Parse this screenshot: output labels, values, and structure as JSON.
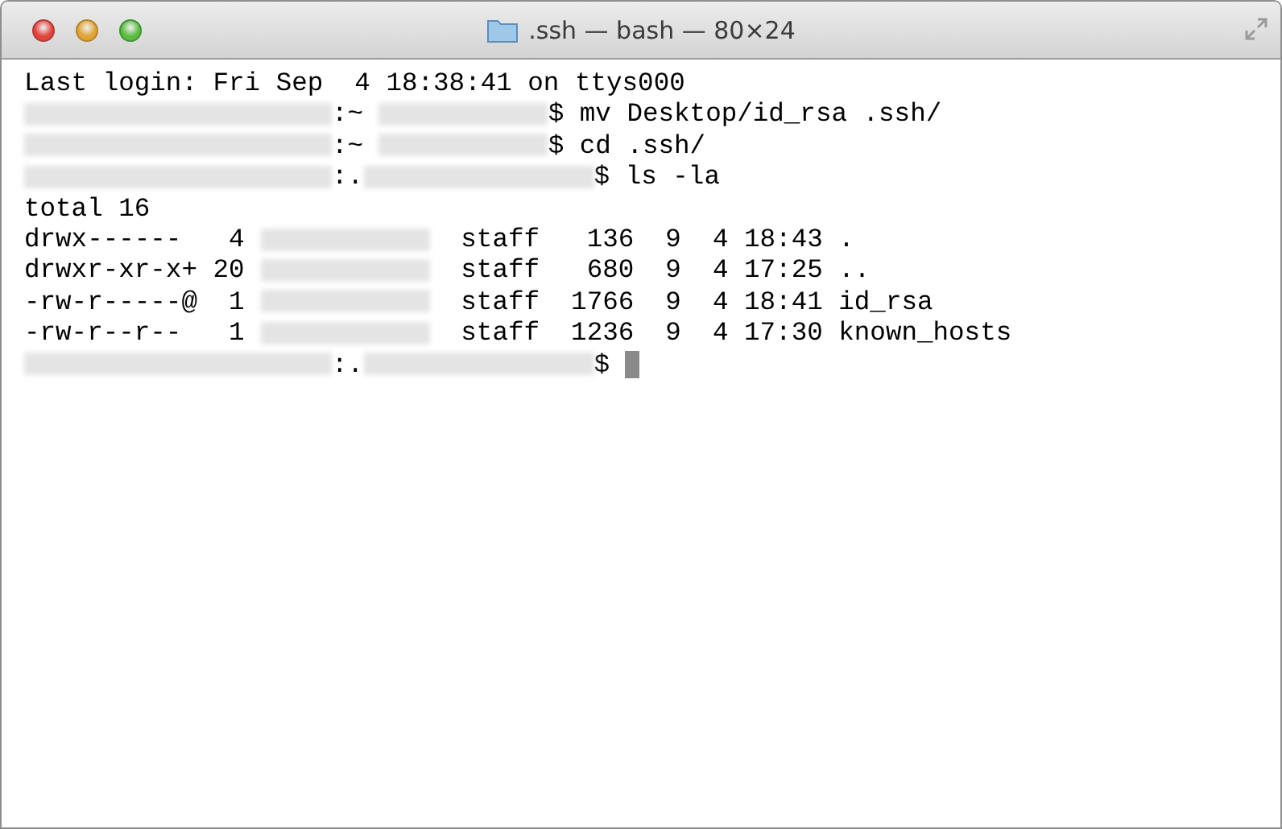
{
  "window": {
    "title": ".ssh — bash — 80×24"
  },
  "terminal": {
    "lines": [
      {
        "segments": [
          {
            "kind": "text",
            "text": "Last login: Fri Sep  4 18:38:41 on ttys000"
          }
        ]
      },
      {
        "segments": [
          {
            "kind": "redacted"
          },
          {
            "kind": "text",
            "text": ":~ "
          },
          {
            "kind": "redacted"
          },
          {
            "kind": "text",
            "text": "$ mv Desktop/id_rsa .ssh/"
          }
        ]
      },
      {
        "segments": [
          {
            "kind": "redacted"
          },
          {
            "kind": "text",
            "text": ":~ "
          },
          {
            "kind": "redacted"
          },
          {
            "kind": "text",
            "text": "$ cd .ssh/"
          }
        ]
      },
      {
        "segments": [
          {
            "kind": "redacted"
          },
          {
            "kind": "text",
            "text": ":."
          },
          {
            "kind": "redacted"
          },
          {
            "kind": "text",
            "text": "$ ls -la"
          }
        ]
      },
      {
        "segments": [
          {
            "kind": "text",
            "text": "total 16"
          }
        ]
      },
      {
        "segments": [
          {
            "kind": "text",
            "text": "drwx------   4 "
          },
          {
            "kind": "redacted"
          },
          {
            "kind": "text",
            "text": "  staff   136  9  4 18:43 ."
          }
        ]
      },
      {
        "segments": [
          {
            "kind": "text",
            "text": "drwxr-xr-x+ 20 "
          },
          {
            "kind": "redacted"
          },
          {
            "kind": "text",
            "text": "  staff   680  9  4 17:25 .."
          }
        ]
      },
      {
        "segments": [
          {
            "kind": "text",
            "text": "-rw-r-----@  1 "
          },
          {
            "kind": "redacted"
          },
          {
            "kind": "text",
            "text": "  staff  1766  9  4 18:41 id_rsa"
          }
        ]
      },
      {
        "segments": [
          {
            "kind": "text",
            "text": "-rw-r--r--   1 "
          },
          {
            "kind": "redacted"
          },
          {
            "kind": "text",
            "text": "  staff  1236  9  4 17:30 known_hosts"
          }
        ]
      },
      {
        "segments": [
          {
            "kind": "redacted"
          },
          {
            "kind": "text",
            "text": ":."
          },
          {
            "kind": "redacted"
          },
          {
            "kind": "text",
            "text": "$ "
          },
          {
            "kind": "cursor"
          }
        ]
      }
    ]
  }
}
